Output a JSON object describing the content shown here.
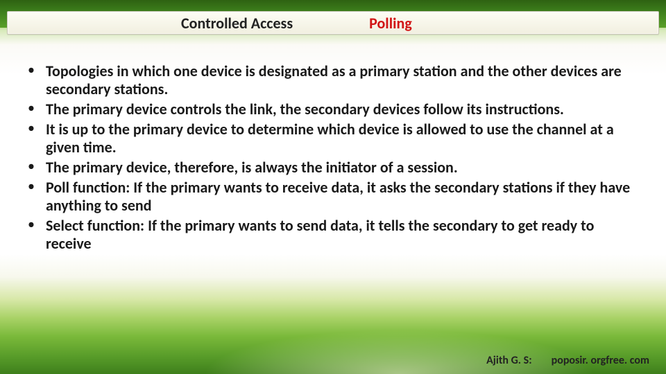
{
  "title": {
    "left": "Controlled Access",
    "right": "Polling"
  },
  "bullets": [
    "Topologies in which one device is designated as a primary station and the other devices are secondary stations.",
    "The primary device controls the link, the secondary devices follow its instructions.",
    "It is up to the primary device to determine which device is allowed to use the channel at a given time.",
    "The primary device, therefore, is always the initiator of a session.",
    "Poll function: If the primary wants to receive data, it asks the secondary stations if they have anything to send",
    "Select function: If the primary wants to send data, it tells the secondary to get ready to receive"
  ],
  "footer": {
    "author": "Ajith G. S:",
    "site": "poposir. orgfree. com"
  }
}
